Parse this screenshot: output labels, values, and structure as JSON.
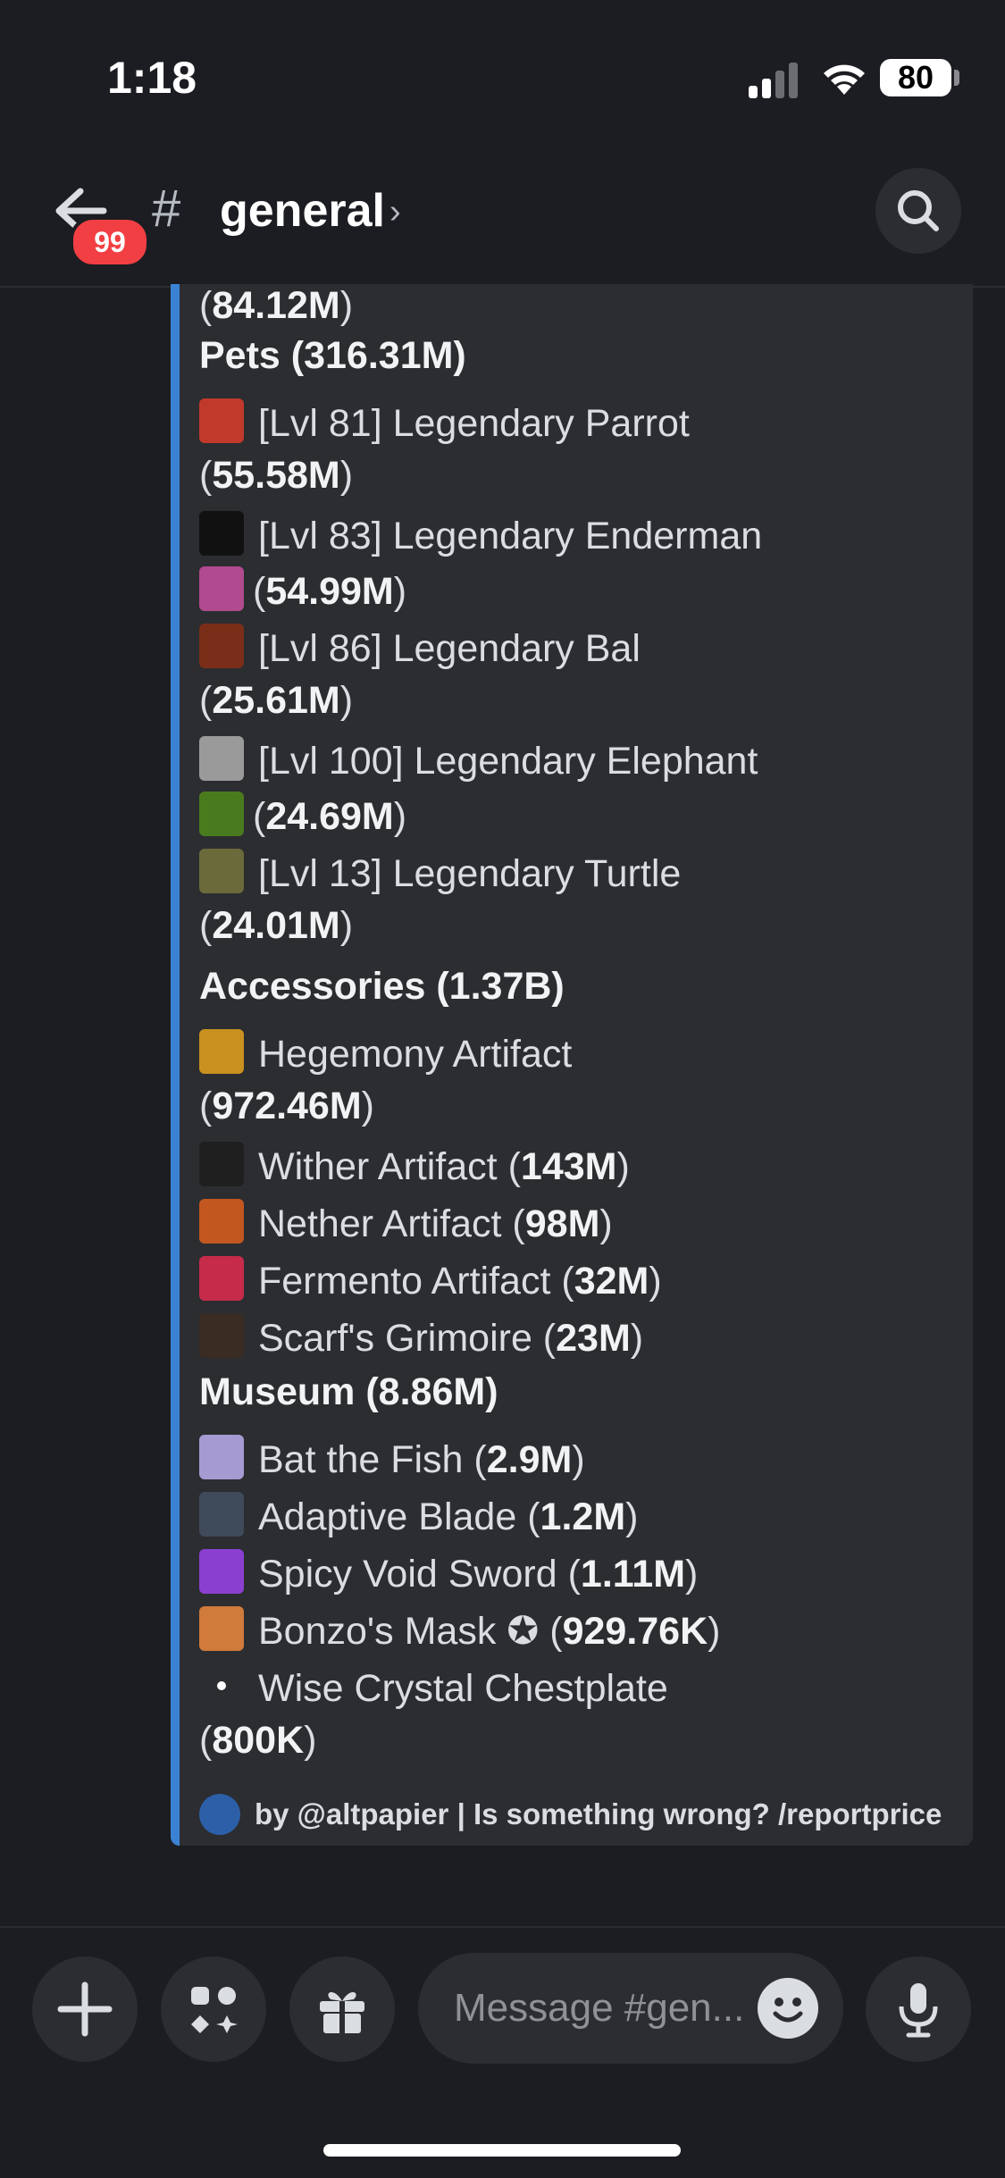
{
  "status_bar": {
    "time": "1:18",
    "battery": "80"
  },
  "header": {
    "unread_count": "99",
    "hash": "#",
    "channel": "general",
    "chevron": "›"
  },
  "embed": {
    "top_value": "84.12M",
    "pets": {
      "heading": "Pets (316.31M)",
      "items": [
        {
          "name": "[Lvl 81] Legendary Parrot",
          "value": "55.58M",
          "icon": "parrot-pet-icon"
        },
        {
          "name": "[Lvl 83] Legendary Enderman",
          "value": "54.99M",
          "icon": "enderman-pet-icon"
        },
        {
          "name": "[Lvl 86] Legendary Bal",
          "value": "25.61M",
          "icon": "bal-pet-icon"
        },
        {
          "name": "[Lvl 100] Legendary Elephant",
          "value": "24.69M",
          "icon": "elephant-pet-icon"
        },
        {
          "name": "[Lvl 13] Legendary Turtle",
          "value": "24.01M",
          "icon": "turtle-pet-icon"
        }
      ]
    },
    "accessories": {
      "heading": "Accessories (1.37B)",
      "items": [
        {
          "name": "Hegemony Artifact",
          "value": "972.46M"
        },
        {
          "name": "Wither Artifact",
          "value": "143M"
        },
        {
          "name": "Nether Artifact",
          "value": "98M"
        },
        {
          "name": "Fermento Artifact",
          "value": "32M"
        },
        {
          "name": "Scarf's Grimoire",
          "value": "23M"
        }
      ]
    },
    "museum": {
      "heading": "Museum (8.86M)",
      "items": [
        {
          "name": "Bat the Fish",
          "value": "2.9M"
        },
        {
          "name": "Adaptive Blade",
          "value": "1.2M"
        },
        {
          "name": "Spicy Void Sword",
          "value": "1.11M"
        },
        {
          "name": "Bonzo's Mask ✪",
          "value": "929.76K"
        },
        {
          "name": "Wise Crystal Chestplate",
          "value": "800K"
        }
      ]
    },
    "footer": "by @altpapier | Is something wrong? /reportprice"
  },
  "composer": {
    "placeholder": "Message #gen..."
  },
  "colors": {
    "accent": "#3b82d4",
    "badge": "#f23f43",
    "background": "#1c1d22",
    "embed_bg": "#2b2d31"
  }
}
